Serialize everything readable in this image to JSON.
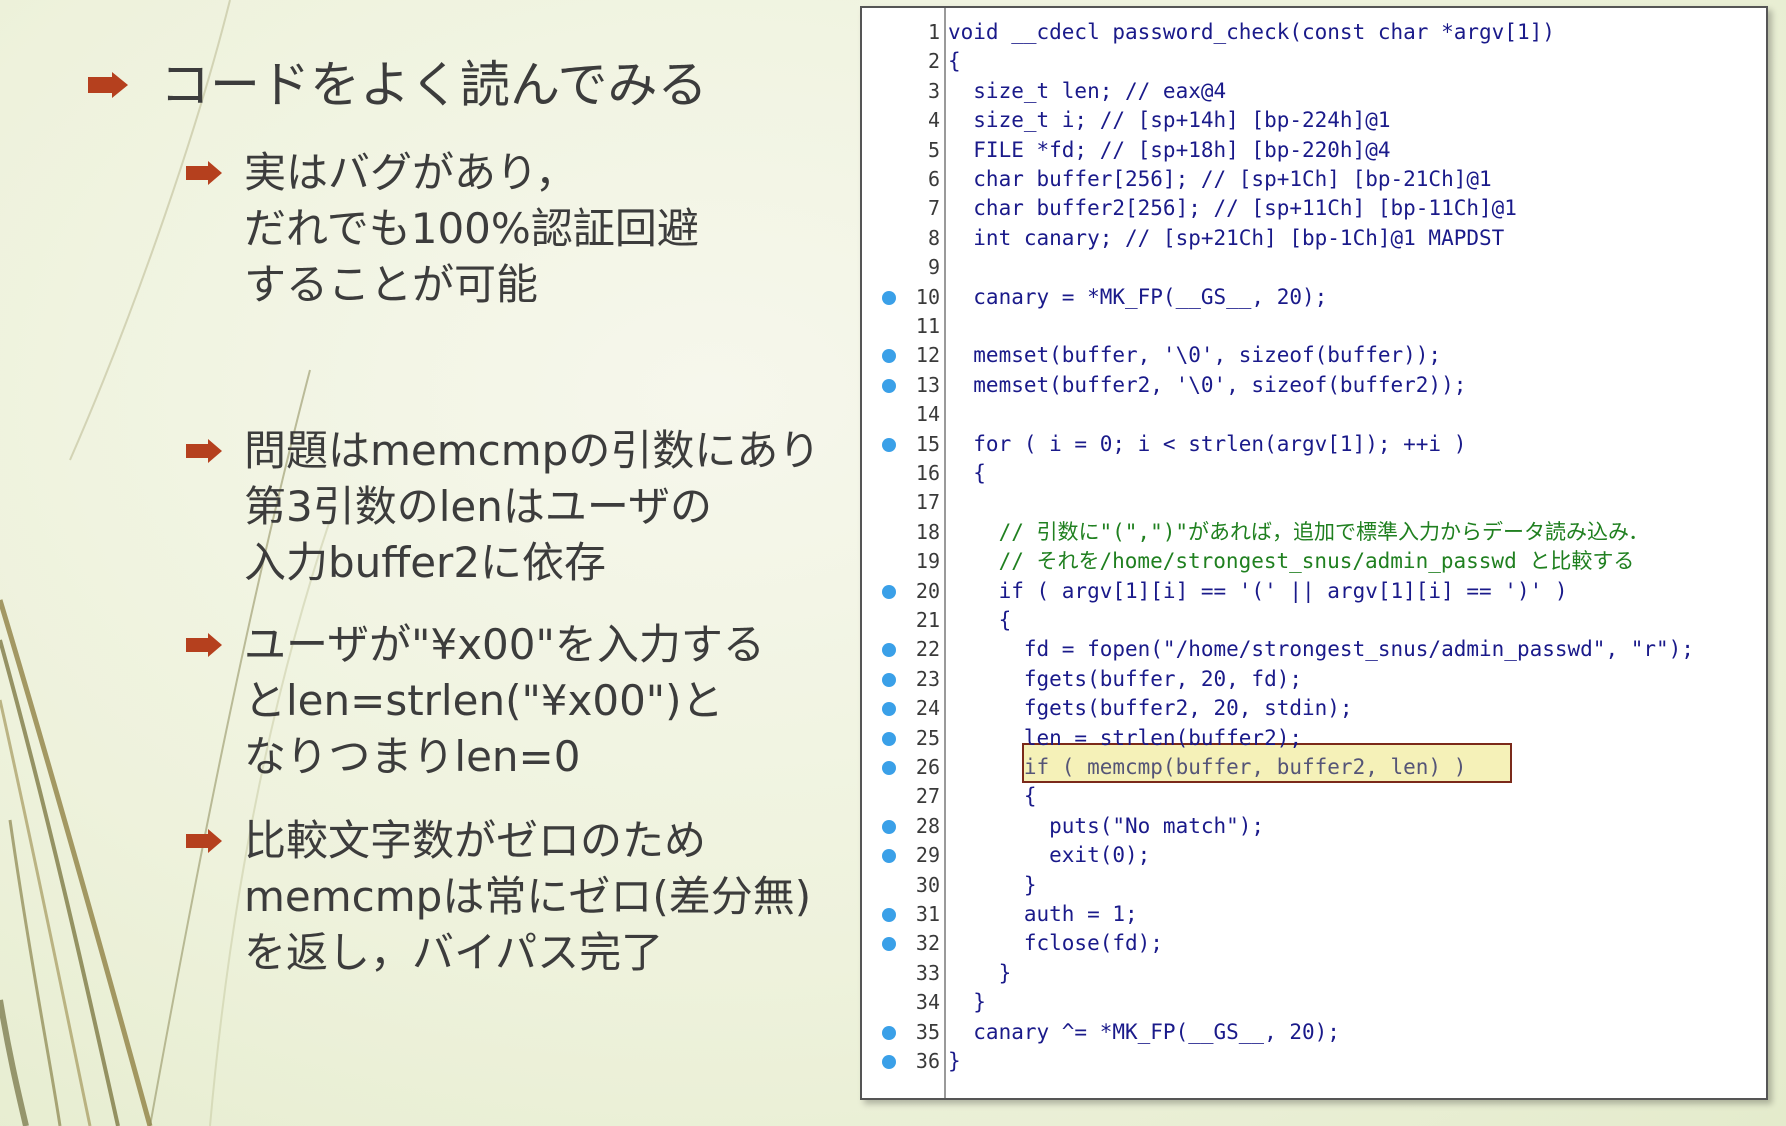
{
  "slide": {
    "main_bullet": "コードをよく読んでみる",
    "sub_bullets": [
      {
        "lines": [
          "実はバグがあり，",
          "だれでも100%認証回避",
          "することが可能"
        ]
      },
      {
        "lines": [
          "問題はmemcmpの引数にあり",
          "第3引数のlenはユーザの",
          "入力buffer2に依存"
        ]
      },
      {
        "lines": [
          "ユーザが\"¥x00\"を入力する",
          "とlen=strlen(\"¥x00\")と",
          "なりつまりlen=0"
        ]
      },
      {
        "lines": [
          "比較文字数がゼロのため",
          "memcmpは常にゼロ(差分無)",
          "を返し，バイパス完了"
        ]
      }
    ],
    "accent_color": "#b5401e"
  },
  "code": {
    "breakpoint_color": "#3aa0e8",
    "highlight_line": 26,
    "lines": [
      {
        "n": "1",
        "bp": false,
        "text": "void __cdecl password_check(const char *argv[1])"
      },
      {
        "n": "2",
        "bp": false,
        "text": "{"
      },
      {
        "n": "3",
        "bp": false,
        "text": "  size_t len; // eax@4"
      },
      {
        "n": "4",
        "bp": false,
        "text": "  size_t i; // [sp+14h] [bp-224h]@1"
      },
      {
        "n": "5",
        "bp": false,
        "text": "  FILE *fd; // [sp+18h] [bp-220h]@4"
      },
      {
        "n": "6",
        "bp": false,
        "text": "  char buffer[256]; // [sp+1Ch] [bp-21Ch]@1"
      },
      {
        "n": "7",
        "bp": false,
        "text": "  char buffer2[256]; // [sp+11Ch] [bp-11Ch]@1"
      },
      {
        "n": "8",
        "bp": false,
        "text": "  int canary; // [sp+21Ch] [bp-1Ch]@1 MAPDST"
      },
      {
        "n": "9",
        "bp": false,
        "text": ""
      },
      {
        "n": "10",
        "bp": true,
        "text": "  canary = *MK_FP(__GS__, 20);"
      },
      {
        "n": "11",
        "bp": false,
        "text": ""
      },
      {
        "n": "12",
        "bp": true,
        "text": "  memset(buffer, '\\0', sizeof(buffer));"
      },
      {
        "n": "13",
        "bp": true,
        "text": "  memset(buffer2, '\\0', sizeof(buffer2));"
      },
      {
        "n": "14",
        "bp": false,
        "text": ""
      },
      {
        "n": "15",
        "bp": true,
        "text": "  for ( i = 0; i < strlen(argv[1]); ++i )"
      },
      {
        "n": "16",
        "bp": false,
        "text": "  {"
      },
      {
        "n": "17",
        "bp": false,
        "text": ""
      },
      {
        "n": "18",
        "bp": false,
        "text": "    // 引数に\"(\",\")\"があれば，追加で標準入力からデータ読み込み．"
      },
      {
        "n": "19",
        "bp": false,
        "text": "    // それを/home/strongest_snus/admin_passwd と比較する"
      },
      {
        "n": "20",
        "bp": true,
        "text": "    if ( argv[1][i] == '(' || argv[1][i] == ')' )"
      },
      {
        "n": "21",
        "bp": false,
        "text": "    {"
      },
      {
        "n": "22",
        "bp": true,
        "text": "      fd = fopen(\"/home/strongest_snus/admin_passwd\", \"r\");"
      },
      {
        "n": "23",
        "bp": true,
        "text": "      fgets(buffer, 20, fd);"
      },
      {
        "n": "24",
        "bp": true,
        "text": "      fgets(buffer2, 20, stdin);"
      },
      {
        "n": "25",
        "bp": true,
        "text": "      len = strlen(buffer2);"
      },
      {
        "n": "26",
        "bp": true,
        "text": "      if ( memcmp(buffer, buffer2, len) )"
      },
      {
        "n": "27",
        "bp": false,
        "text": "      {"
      },
      {
        "n": "28",
        "bp": true,
        "text": "        puts(\"No match\");"
      },
      {
        "n": "29",
        "bp": true,
        "text": "        exit(0);"
      },
      {
        "n": "30",
        "bp": false,
        "text": "      }"
      },
      {
        "n": "31",
        "bp": true,
        "text": "      auth = 1;"
      },
      {
        "n": "32",
        "bp": true,
        "text": "      fclose(fd);"
      },
      {
        "n": "33",
        "bp": false,
        "text": "    }"
      },
      {
        "n": "34",
        "bp": false,
        "text": "  }"
      },
      {
        "n": "35",
        "bp": true,
        "text": "  canary ^= *MK_FP(__GS__, 20);"
      },
      {
        "n": "36",
        "bp": true,
        "text": "}"
      }
    ]
  }
}
